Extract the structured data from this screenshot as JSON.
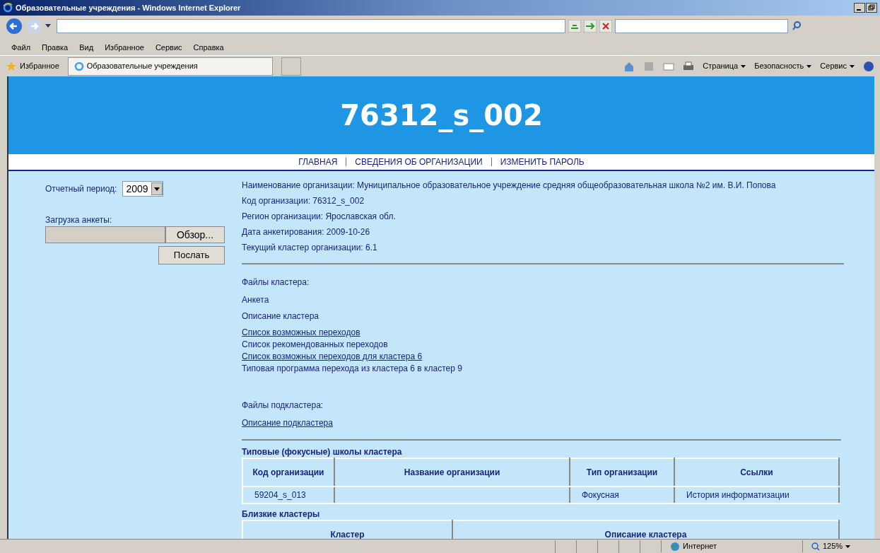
{
  "window": {
    "title": "Образовательные учреждения - Windows Internet Explorer"
  },
  "menu": [
    "Файл",
    "Правка",
    "Вид",
    "Избранное",
    "Сервис",
    "Справка"
  ],
  "favorites": {
    "label": "Избранное",
    "tab": "Образовательные учреждения"
  },
  "command_bar": [
    "Страница",
    "Безопасность",
    "Сервис"
  ],
  "header": {
    "title": "76312_s_002"
  },
  "nav": [
    "ГЛАВНАЯ",
    "СВЕДЕНИЯ ОБ ОРГАНИЗАЦИИ",
    "ИЗМЕНИТЬ ПАРОЛЬ"
  ],
  "sidebar": {
    "period_label": "Отчетный период:",
    "period_value": "2009",
    "upload_label": "Загрузка анкеты:",
    "browse_button": "Обзор...",
    "send_button": "Послать"
  },
  "info": [
    "Наименование организации: Муниципальное образовательное учреждение средняя общеобразовательная школа №2 им. В.И. Попова",
    "Код организации: 76312_s_002",
    "Регион организации: Ярославская обл.",
    "Дата анкетирования: 2009-10-26",
    "Текущий кластер организации: 6.1"
  ],
  "cluster_files": {
    "heading": "Файлы кластера:",
    "items": [
      {
        "kind": "text",
        "label": "Анкета"
      },
      {
        "kind": "text",
        "label": "Описание кластера"
      },
      {
        "kind": "link",
        "label": "Список возможных переходов"
      },
      {
        "kind": "text",
        "label": "Список рекомендованных переходов"
      },
      {
        "kind": "link",
        "label": "Список возможных переходов для кластера 6"
      },
      {
        "kind": "text",
        "label": "Типовая программа перехода из кластера 6 в кластер 9"
      }
    ]
  },
  "subcluster_files": {
    "heading": "Файлы подкластера:",
    "items": [
      {
        "kind": "link",
        "label": "Описание подкластера"
      }
    ]
  },
  "focus_schools": {
    "title": "Типовые (фокусные) школы кластера",
    "columns": [
      "Код организации",
      "Название организации",
      "Тип организации",
      "Ссылки"
    ],
    "rows": [
      [
        "59204_s_013",
        "",
        "Фокусная",
        "История информатизации"
      ]
    ]
  },
  "near_clusters": {
    "title": "Близкие кластеры",
    "columns": [
      "Кластер",
      "Описание кластера"
    ]
  },
  "status_bar": {
    "zone": "Интернет",
    "zoom": "125%"
  }
}
